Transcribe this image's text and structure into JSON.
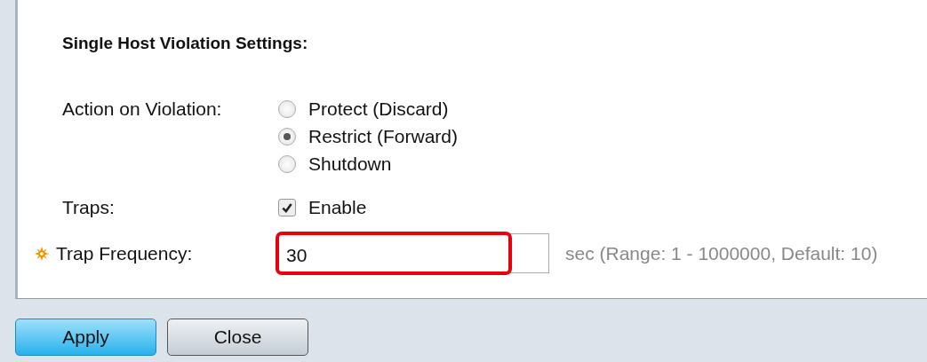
{
  "section_title": "Single Host Violation Settings:",
  "action_on_violation": {
    "label": "Action on Violation:",
    "options": [
      {
        "label": "Protect (Discard)",
        "selected": false
      },
      {
        "label": "Restrict (Forward)",
        "selected": true
      },
      {
        "label": "Shutdown",
        "selected": false
      }
    ]
  },
  "traps": {
    "label": "Traps:",
    "option": "Enable",
    "checked": true
  },
  "trap_frequency": {
    "label": "Trap Frequency:",
    "required": true,
    "value": "30",
    "highlighted": true,
    "hint": "sec (Range: 1 - 1000000, Default: 10)"
  },
  "buttons": [
    {
      "label": "Apply",
      "kind": "primary"
    },
    {
      "label": "Close",
      "kind": "secondary"
    }
  ]
}
